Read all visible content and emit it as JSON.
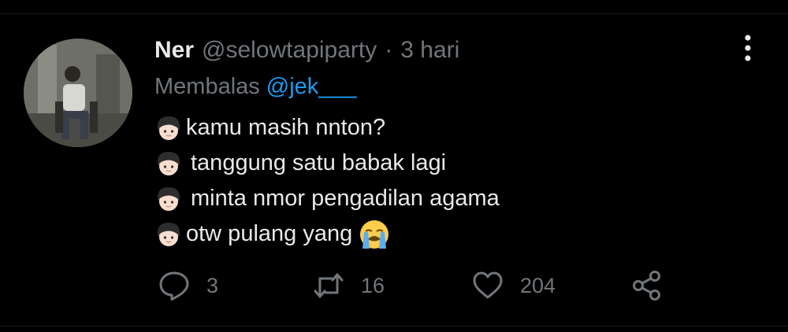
{
  "tweet": {
    "display_name": "Ner",
    "handle": "@selowtapiparty",
    "separator": "·",
    "time": "3 hari",
    "reply_prefix": "Membalas",
    "reply_to": "@jek___",
    "lines": [
      {
        "text": "kamu masih nnton?",
        "emoji": "person-face-emoji"
      },
      {
        "text": "tanggung satu babak lagi",
        "emoji": "person-face-emoji"
      },
      {
        "text": "minta nmor pengadilan agama",
        "emoji": "person-face-emoji"
      },
      {
        "text": "otw pulang yang",
        "emoji": "person-face-emoji",
        "trailing_emoji": "loudly-crying-face-emoji"
      }
    ]
  },
  "actions": {
    "reply": {
      "icon": "reply-icon",
      "count": "3"
    },
    "retweet": {
      "icon": "retweet-icon",
      "count": "16"
    },
    "like": {
      "icon": "heart-icon",
      "count": "204"
    },
    "share": {
      "icon": "share-icon"
    }
  },
  "colors": {
    "background": "#000000",
    "text_primary": "#e7e9ea",
    "text_secondary": "#71767b",
    "accent": "#1d9bf0"
  }
}
